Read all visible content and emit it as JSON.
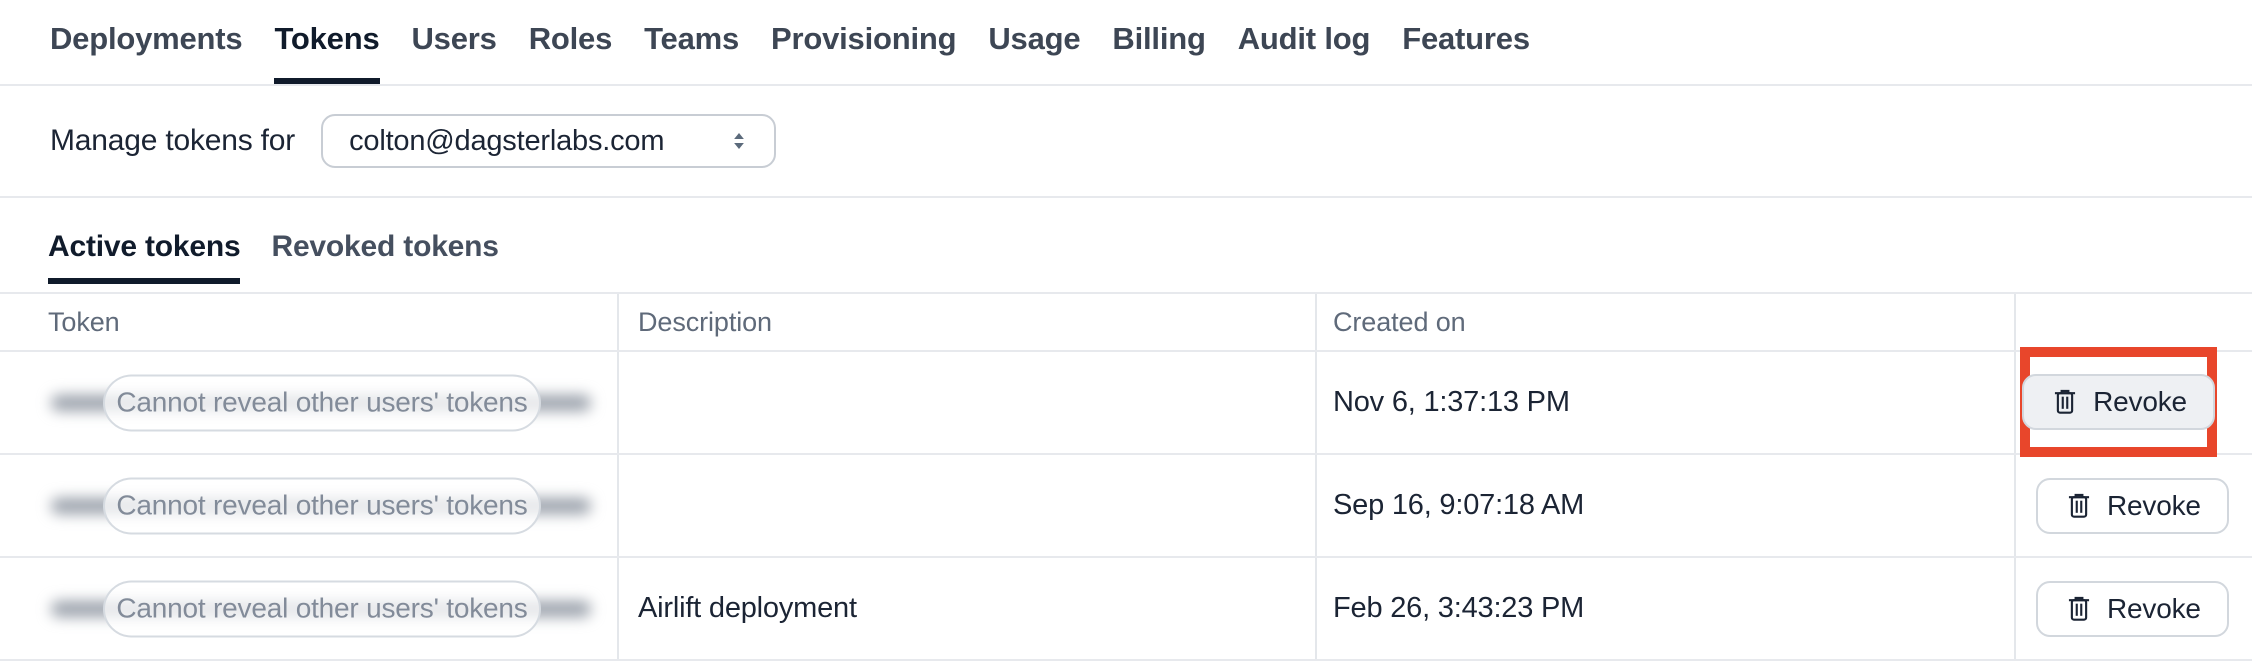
{
  "nav": {
    "tabs": [
      {
        "label": "Deployments",
        "active": false
      },
      {
        "label": "Tokens",
        "active": true
      },
      {
        "label": "Users",
        "active": false
      },
      {
        "label": "Roles",
        "active": false
      },
      {
        "label": "Teams",
        "active": false
      },
      {
        "label": "Provisioning",
        "active": false
      },
      {
        "label": "Usage",
        "active": false
      },
      {
        "label": "Billing",
        "active": false
      },
      {
        "label": "Audit log",
        "active": false
      },
      {
        "label": "Features",
        "active": false
      }
    ]
  },
  "manage": {
    "label": "Manage tokens for",
    "selected_user": "colton@dagsterlabs.com",
    "select_icon": "up-down-chevrons-icon"
  },
  "token_tabs": {
    "active_label": "Active tokens",
    "revoked_label": "Revoked tokens"
  },
  "table": {
    "columns": {
      "token": "Token",
      "description": "Description",
      "created_on": "Created on"
    },
    "rows": [
      {
        "token_placeholder": "Cannot reveal other users' tokens",
        "description": "",
        "created_on": "Nov 6, 1:37:13 PM",
        "action_label": "Revoke",
        "action_icon": "trash-icon",
        "highlighted": true
      },
      {
        "token_placeholder": "Cannot reveal other users' tokens",
        "description": "",
        "created_on": "Sep 16, 9:07:18 AM",
        "action_label": "Revoke",
        "action_icon": "trash-icon",
        "highlighted": false
      },
      {
        "token_placeholder": "Cannot reveal other users' tokens",
        "description": "Airlift deployment",
        "created_on": "Feb 26, 3:43:23 PM",
        "action_label": "Revoke",
        "action_icon": "trash-icon",
        "highlighted": false
      }
    ]
  },
  "colors": {
    "annotation_red": "#e8462b",
    "text_dark": "#1b2434",
    "text_gray_header": "#5f6a7a",
    "text_gray_pill": "#828b99",
    "border_light": "#e7e9ed",
    "active_tab_underline": "#101b2b"
  }
}
